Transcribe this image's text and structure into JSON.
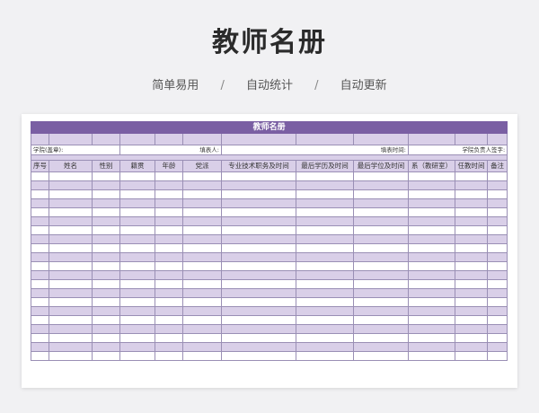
{
  "header": {
    "title": "教师名册",
    "features": [
      "简单易用",
      "自动统计",
      "自动更新"
    ],
    "separator": "/"
  },
  "sheet": {
    "title": "教师名册",
    "info": {
      "college_label": "学院(盖章):",
      "filler_label": "填表人:",
      "date_label": "填表时间:",
      "signature_label": "学院负责人签字:"
    },
    "columns": [
      "序号",
      "姓名",
      "性别",
      "籍贯",
      "年龄",
      "党派",
      "专业技术职务及时间",
      "最后学历及时间",
      "最后学位及时间",
      "系（教研室）",
      "任教时间",
      "备注"
    ],
    "row_count": 21
  },
  "colors": {
    "accent": "#7a5fa3",
    "band": "#d9cfe8",
    "border": "#9a8fb5",
    "page_bg": "#f1f1f3"
  }
}
